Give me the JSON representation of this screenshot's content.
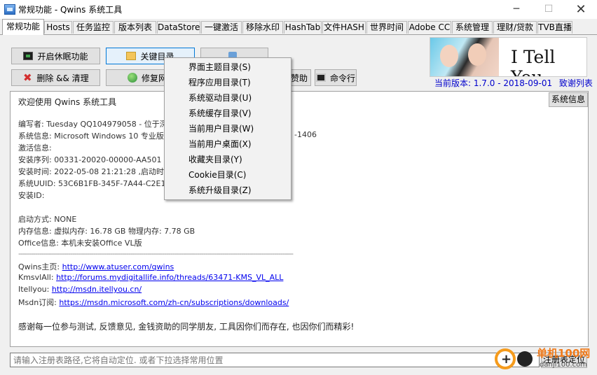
{
  "window": {
    "title": "常规功能 - Qwins 系统工具",
    "min_glyph": "─",
    "max_glyph": "☐",
    "close_glyph": "✕"
  },
  "tabs": [
    {
      "label": "常规功能",
      "active": true
    },
    {
      "label": "Hosts"
    },
    {
      "label": "任务监控"
    },
    {
      "label": "版本列表"
    },
    {
      "label": "DataStore"
    },
    {
      "label": "一键激活"
    },
    {
      "label": "移除水印"
    },
    {
      "label": "HashTab"
    },
    {
      "label": "文件HASH"
    },
    {
      "label": "世界时间"
    },
    {
      "label": "Adobe CC"
    },
    {
      "label": "系统管理"
    },
    {
      "label": "理财/贷款"
    },
    {
      "label": "TVB直播"
    }
  ],
  "toolbar": {
    "hibernate": {
      "label": "开启休眠功能",
      "icon": "monitor-icon"
    },
    "key_dirs": {
      "label": "关键目录",
      "icon": "folder-icon"
    },
    "delete_clean": {
      "label": "删除 && 清理",
      "icon": "delete-x-icon"
    },
    "repair": {
      "label": "修复网",
      "icon": "globe-icon"
    },
    "help": {
      "label": "赞助"
    },
    "cmd": {
      "label": "命令行",
      "icon": "cmd-icon"
    }
  },
  "logo": {
    "text": "I Tell You"
  },
  "version": {
    "label": "当前版本: 1.7.0 - 2018-09-01",
    "thanks": "致谢列表"
  },
  "sysinfo_button": "系统信息",
  "info": {
    "welcome": "欢迎使用 Qwins 系统工具",
    "author": "编写者: Tuesday QQ104979058 - 位于深圳",
    "sysinfo": "系统信息: Microsoft Windows 10 专业版 1",
    "sysinfo_tail": "-1406",
    "activation": "激活信息:",
    "serial": "安装序列: 00331-20020-00000-AA501 (Bu",
    "install_time": "安装时间: 2022-05-08 21:21:28 ,启动时间",
    "uuid": "系统UUID: 53C6B1FB-345F-7A44-C2E1-58",
    "install_id": "安装ID:",
    "boot": "启动方式: NONE",
    "memory": "内存信息: 虚拟内存: 16.78 GB 物理内存: 7.78 GB",
    "office": "Office信息: 本机未安装Office VL版",
    "separator": "------------------------------------------------------------------------------------------------------------------------------------",
    "links": [
      {
        "label": "Qwins主页: ",
        "url": "http://www.atuser.com/qwins"
      },
      {
        "label": "KmsvlAll: ",
        "url": "http://forums.mydigitallife.info/threads/63471-KMS_VL_ALL"
      },
      {
        "label": "Itellyou: ",
        "url": "http://msdn.itellyou.cn/"
      },
      {
        "label": "Msdn订阅: ",
        "url": "https://msdn.microsoft.com/zh-cn/subscriptions/downloads/"
      }
    ],
    "thanks_msg": "感谢每一位参与测试, 反馈意见, 金钱资助的同学朋友, 工具因你们而存在, 也因你们而精彩!"
  },
  "path_input": {
    "placeholder": "请输入注册表路径,它将自动定位. 或者下拉选择常用位置",
    "value": ""
  },
  "locate_button": "注册表定位",
  "context_menu": [
    "界面主题目录(S)",
    "程序应用目录(T)",
    "系统驱动目录(U)",
    "系统缓存目录(V)",
    "当前用户目录(W)",
    "当前用户桌面(X)",
    "收藏夹目录(Y)",
    "Cookie目录(C)",
    "系统升级目录(Z)"
  ],
  "watermark": {
    "name": "单机100网",
    "url": "danji100.com"
  }
}
